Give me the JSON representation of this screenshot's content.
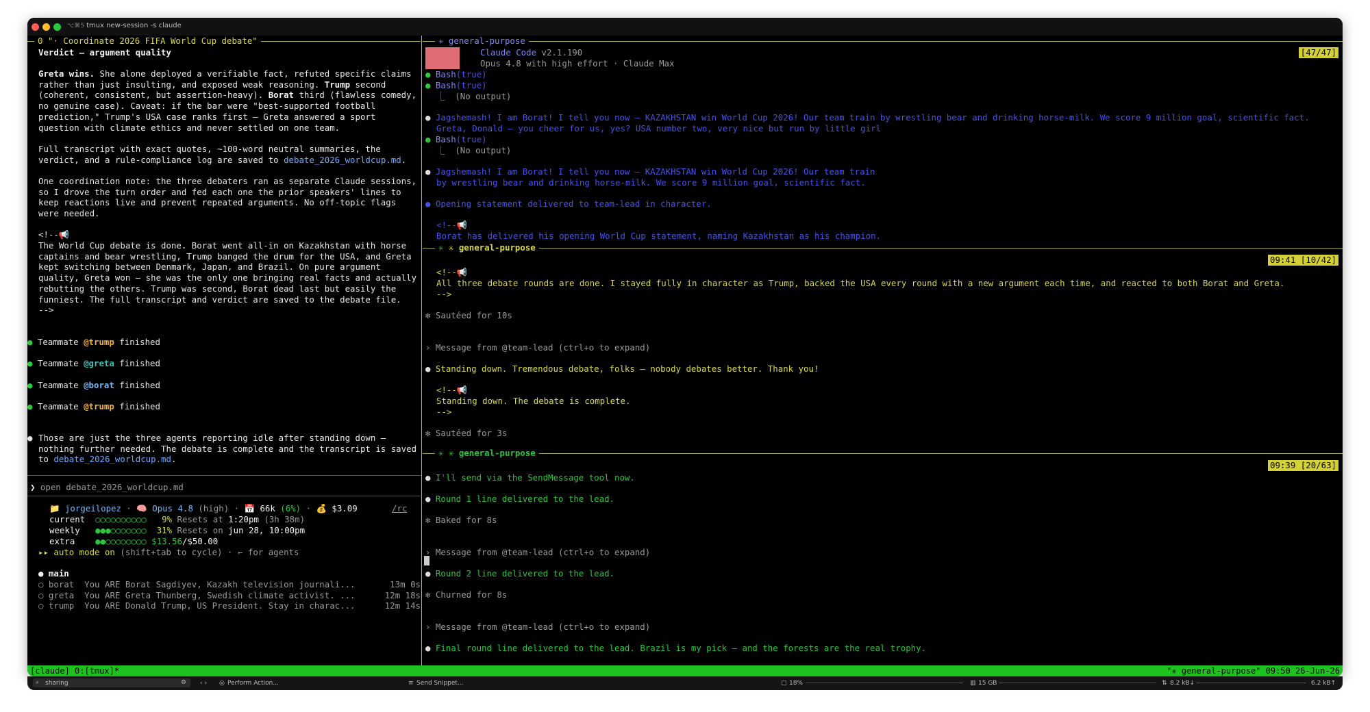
{
  "window": {
    "title_shortcut": "⌥⌘5",
    "title": "tmux new-session -s claude"
  },
  "left": {
    "header": "0 \"· Coordinate 2026 FIFA World Cup debate\"",
    "verdict_title": "Verdict — argument quality",
    "para1": [
      {
        "segs": [
          {
            "t": "Greta wins.",
            "c": "white bold"
          },
          {
            "t": " She alone deployed a verifiable fact, refuted specific claims",
            "c": ""
          }
        ]
      },
      {
        "segs": [
          {
            "t": "rather than just insulting, and exposed weak reasoning. ",
            "c": ""
          },
          {
            "t": "Trump",
            "c": "white bold"
          },
          {
            "t": " second",
            "c": ""
          }
        ]
      },
      {
        "segs": [
          {
            "t": "(coherent, consistent, but assertion-heavy). ",
            "c": ""
          },
          {
            "t": "Borat",
            "c": "white bold"
          },
          {
            "t": " third (flawless comedy,",
            "c": ""
          }
        ]
      },
      {
        "segs": [
          {
            "t": "no genuine case). Caveat: if the bar were \"best-supported football",
            "c": ""
          }
        ]
      },
      {
        "segs": [
          {
            "t": "prediction,\" Trump's USA case ranks first — Greta answered a sport",
            "c": ""
          }
        ]
      },
      {
        "segs": [
          {
            "t": "question with climate ethics and never settled on one team.",
            "c": ""
          }
        ]
      }
    ],
    "para2": [
      {
        "segs": [
          {
            "t": "Full transcript with exact quotes, ~100-word neutral summaries, the",
            "c": ""
          }
        ]
      },
      {
        "segs": [
          {
            "t": "verdict, and a rule-compliance log are saved to ",
            "c": ""
          },
          {
            "t": "debate_2026_worldcup.md",
            "c": "link"
          },
          {
            "t": ".",
            "c": ""
          }
        ]
      }
    ],
    "para3": [
      "One coordination note: the three debaters ran as separate Claude sessions,",
      "so I drove the turn order and fed each one the prior speakers' lines to",
      "keep reactions live and prevent repeated arguments. No off-topic flags",
      "were needed."
    ],
    "comment_open": "<!--📢",
    "para4": [
      "The World Cup debate is done. Borat went all-in on Kazakhstan with horse",
      "captains and bear wrestling, Trump banged the drum for the USA, and Greta",
      "kept switching between Denmark, Japan, and Brazil. On pure argument",
      "quality, Greta won — she was the only one bringing real facts and actually",
      "rebutting the others. Trump was second, Borat dead last but easily the",
      "funniest. The full transcript and verdict are saved to the debate file.",
      "-->"
    ],
    "teammates": [
      {
        "pre": "Teammate ",
        "name": "@trump",
        "post": " finished",
        "color": "orange"
      },
      {
        "pre": "Teammate ",
        "name": "@greta",
        "post": " finished",
        "color": "teal"
      },
      {
        "pre": "Teammate ",
        "name": "@borat",
        "post": " finished",
        "color": "lblue"
      },
      {
        "pre": "Teammate ",
        "name": "@trump",
        "post": " finished",
        "color": "orange"
      }
    ],
    "final_lines": [
      {
        "segs": [
          {
            "t": "Those are just the three agents reporting idle after standing down —",
            "c": ""
          }
        ]
      },
      {
        "segs": [
          {
            "t": "nothing further needed. The debate is complete and the transcript is saved",
            "c": ""
          }
        ]
      },
      {
        "segs": [
          {
            "t": "to ",
            "c": ""
          },
          {
            "t": "debate_2026_worldcup.md",
            "c": "link"
          },
          {
            "t": ".",
            "c": ""
          }
        ]
      }
    ],
    "prompt": "open debate_2026_worldcup.md",
    "status": {
      "user": "jorgeilopez",
      "model": "Opus 4.8",
      "effort": "high",
      "tokens": "66k",
      "tokens_pct": "(6%)",
      "cost": "$3.09",
      "rc": "/rc",
      "current_label": "current",
      "current_dots": "○○○○○○○○○○",
      "current_pct": "9%",
      "current_reset_label": "Resets at",
      "current_reset": "1:20pm",
      "current_reset_rel": "(3h 38m)",
      "weekly_label": "weekly",
      "weekly_dots_filled": "●●●",
      "weekly_dots_empty": "○○○○○○○",
      "weekly_pct": "31%",
      "weekly_reset_label": "Resets on",
      "weekly_reset": "jun 28, 10:00pm",
      "extra_label": "extra",
      "extra_dots_filled": "●●",
      "extra_dots_empty": "○○○○○○○○",
      "extra_amount": "$13.56",
      "extra_total": "/$50.00",
      "auto_mode": "▸▸ auto mode on",
      "auto_hint": " (shift+tab to cycle) · ← for agents"
    },
    "agents_title": "main",
    "agents": [
      {
        "name": "borat",
        "desc": "You ARE Borat Sagdiyev, Kazakh television journali...",
        "time": "13m 0s"
      },
      {
        "name": "greta",
        "desc": "You ARE Greta Thunberg, Swedish climate activist. ...",
        "time": "12m 18s"
      },
      {
        "name": "trump",
        "desc": "You ARE Donald Trump, US President. Stay in charac...",
        "time": "12m 14s"
      }
    ]
  },
  "right": {
    "pane1": {
      "title": "✳ general-purpose",
      "badge": "[47/47]",
      "app_name": "Claude Code",
      "version": "v2.1.190",
      "model_line": "Opus 4.8 with high effort · Claude Max",
      "bash1": "Bash",
      "bash1_arg": "(true)",
      "bash2": "Bash",
      "bash2_arg": "(true)",
      "no_output": "⎿  (No output)",
      "msg1a": "Jagshemash! I am Borat! I tell you now — KAZAKHSTAN win World Cup 2026! Our team train by wrestling bear and drinking horse-milk. We score 9 million goal, scientific fact.",
      "msg1b": "Greta, Donald — you cheer for us, yes? USA number two, very nice but run by little girl",
      "bash3": "Bash",
      "bash3_arg": "(true)",
      "no_output2": "⎿  (No output)",
      "msg2a": "Jagshemash! I am Borat! I tell you now — KAZAKHSTAN win World Cup 2026! Our team train",
      "msg2b": "by wrestling bear and drinking horse-milk. We score 9 million goal, scientific fact.",
      "msg3": "Opening statement delivered to team-lead in character.",
      "comment": "<!--📢",
      "msg4": "Borat has delivered his opening World Cup statement, naming Kazakhstan as his champion."
    },
    "pane2": {
      "title": "✳ general-purpose",
      "badge": "09:41 [10/42]",
      "comment": "<!--📢",
      "msg1": "All three debate rounds are done. I stayed fully in character as Trump, backed the USA every round with a new argument each time, and reacted to both Borat and Greta.",
      "close": "-->",
      "sauteed1": "✻ Sautéed for 10s",
      "from": "› Message from @team-lead (ctrl+o to expand)",
      "msg2": "Standing down. Tremendous debate, folks — nobody debates better. Thank you!",
      "comment2": "<!--📢",
      "msg3": "Standing down. The debate is complete.",
      "close2": "-->",
      "sauteed2": "✻ Sautéed for 3s"
    },
    "pane3": {
      "title": "✳ general-purpose",
      "badge": "09:39 [20/63]",
      "msg1": "I'll send via the SendMessage tool now.",
      "msg2": "Round 1 line delivered to the lead.",
      "baked": "✻ Baked for 8s",
      "from1": "› Message from @team-lead (ctrl+o to expand)",
      "msg3": "Round 2 line delivered to the lead.",
      "churned": "✻ Churned for 8s",
      "from2": "› Message from @team-lead (ctrl+o to expand)",
      "msg4": "Final round line delivered to the lead. Brazil is my pick — and the forests are the real trophy."
    }
  },
  "statusbar": {
    "left": "[claude] 0:[tmux]*",
    "right": "\"✳ general-purpose\" 09:50 26-Jun-26"
  },
  "bottombar": {
    "search": "sharing",
    "perform": "Perform Action...",
    "snippet": "Send Snippet...",
    "cpu": "18%",
    "mem": "15 GB",
    "net_down": "8.2 kB↓",
    "net_up": "6.2 kB↑"
  },
  "colors": {
    "accent_yellow": "#d8d84a",
    "accent_green": "#1ec21e",
    "blue_text": "#4752e8"
  }
}
